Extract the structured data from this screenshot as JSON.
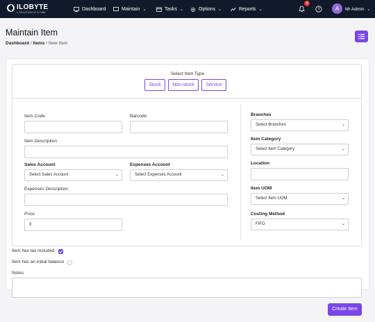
{
  "brand": {
    "name": "ILOBYTE",
    "tagline": "1 SOLUTION AT A TIME"
  },
  "nav": {
    "dashboard": "Dashboard",
    "maintain": "Maintain",
    "tasks": "Tasks",
    "options": "Options",
    "reports": "Reports"
  },
  "header": {
    "notification_count": "4",
    "avatar_letter": "A",
    "user": "Mr Admin"
  },
  "page": {
    "title": "Maintain Item"
  },
  "breadcrumb": {
    "home": "Dashboard",
    "sep1": "/",
    "section": "Items",
    "sep2": "/",
    "current": "New Item"
  },
  "item_type": {
    "label": "Select Item Type",
    "options": [
      "Stock",
      "Non-stock",
      "Service"
    ]
  },
  "form": {
    "item_code_label": "Item Code",
    "barcode_label": "Barcode",
    "item_description_label": "Item Description",
    "sales_account_label": "Sales Account",
    "sales_account_value": "Select Sales Account",
    "expenses_account_label": "Expenses Account",
    "expenses_account_value": "Select Expenses Account",
    "expenses_description_label": "Expenses Description",
    "price_label": "Price",
    "price_value": "0",
    "branches_label": "Branches",
    "branches_value": "Select Branches",
    "item_category_label": "Item Category",
    "item_category_value": "Select Item Category",
    "location_label": "Location",
    "item_uom_label": "Item UOM",
    "item_uom_value": "Select Item UOM",
    "costing_method_label": "Costing Method",
    "costing_method_value": "FIFO",
    "tax_included_label": "Item has tax included",
    "tax_included_checked": true,
    "initial_balance_label": "Item has an initial balance",
    "initial_balance_checked": false,
    "notes_label": "Notes",
    "submit_label": "Create Item"
  },
  "colors": {
    "accent": "#7b45e8",
    "topbar": "#111a2c",
    "badge": "#e53935"
  }
}
